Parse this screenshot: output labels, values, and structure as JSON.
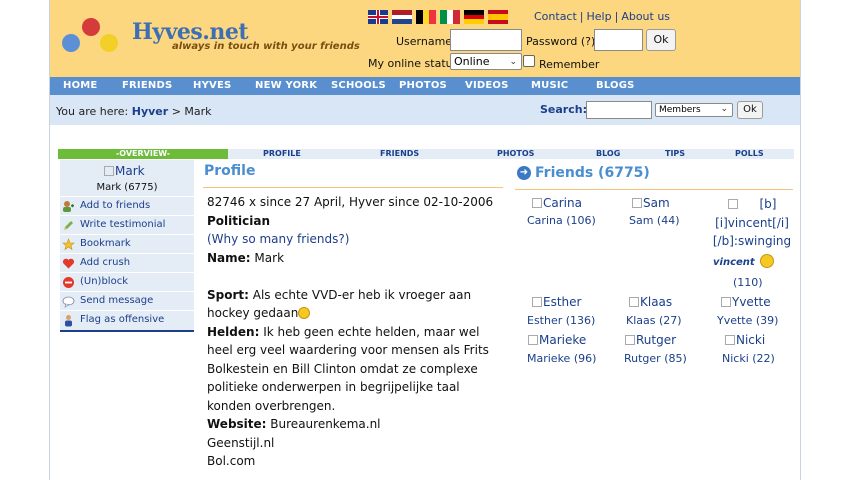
{
  "header": {
    "logo_title": "Hyves.net",
    "logo_tagline": "always in touch with your friends",
    "flags": [
      "english-flag",
      "dutch-flag",
      "belgian-flag",
      "italian-flag",
      "german-flag",
      "spanish-flag"
    ],
    "top_links": [
      "Contact",
      "Help",
      "About us"
    ],
    "username_label": "Username:",
    "password_label": "Password (?)",
    "ok_label": "Ok",
    "status_label": "My online status:",
    "status_value": "Online",
    "remember_label": "Remember"
  },
  "nav": [
    "HOME",
    "FRIENDS",
    "HYVES",
    "NEW YORK",
    "SCHOOLS",
    "PHOTOS",
    "VIDEOS",
    "MUSIC",
    "BLOGS"
  ],
  "breadcrumb": {
    "prefix": "You are here:",
    "root": "Hyver",
    "separator": ">",
    "current": "Mark"
  },
  "search": {
    "label": "Search:",
    "scope": "Members",
    "button": "Ok"
  },
  "tabs": {
    "overview": "-OVERVIEW-",
    "items": [
      "PROFILE",
      "FRIENDS",
      "PHOTOS",
      "BLOG",
      "TIPS",
      "POLLS"
    ]
  },
  "sidebar": {
    "avatar_alt": "Mark",
    "name_count": "Mark (6775)",
    "links": [
      {
        "label": "Add to friends",
        "icon": "add-friend-icon"
      },
      {
        "label": "Write testimonial",
        "icon": "pencil-icon"
      },
      {
        "label": "Bookmark",
        "icon": "star-icon"
      },
      {
        "label": "Add crush",
        "icon": "heart-icon"
      },
      {
        "label": "(Un)block",
        "icon": "block-icon"
      },
      {
        "label": "Send message",
        "icon": "message-icon"
      },
      {
        "label": "Flag as offensive",
        "icon": "flag-user-icon"
      }
    ]
  },
  "profile": {
    "title": "Profile",
    "stats_line": "82746 x since 27 April, Hyver since 02-10-2006",
    "occupation": "Politician",
    "why_link": "(Why so many friends?)",
    "name_label": "Name:",
    "name_value": "Mark",
    "sport_label": "Sport:",
    "sport_value": "Als echte VVD-er heb ik vroeger aan hockey gedaan",
    "heroes_label": "Helden:",
    "heroes_value": "Ik heb geen echte helden, maar wel heel erg veel waardering voor mensen als Frits Bolkestein en Bill Clinton omdat ze complexe politieke onderwerpen in begrijpelijke taal konden overbrengen.",
    "website_label": "Website:",
    "websites": [
      "Bureaurenkema.nl",
      "Geenstijl.nl",
      "Bol.com"
    ]
  },
  "friends": {
    "title": "Friends (6775)",
    "items": [
      {
        "alt": "Carina",
        "label": "Carina (106)"
      },
      {
        "alt": "Sam",
        "label": "Sam (44)"
      },
      {
        "alt": "Esther",
        "label": "Esther (136)"
      },
      {
        "alt": "Klaas",
        "label": "Klaas (27)"
      },
      {
        "alt": "Yvette",
        "label": "Yvette (39)"
      },
      {
        "alt": "Marieke",
        "label": "Marieke (96)"
      },
      {
        "alt": "Rutger",
        "label": "Rutger (85)"
      },
      {
        "alt": "Nicki",
        "label": "Nicki (22)"
      }
    ],
    "vincent_alt_1": "[b]",
    "vincent_alt_2": "[i]vincent[/i]",
    "vincent_alt_3": "[/b]:swinging",
    "vincent_name": "vincent",
    "vincent_count": "(110)"
  }
}
